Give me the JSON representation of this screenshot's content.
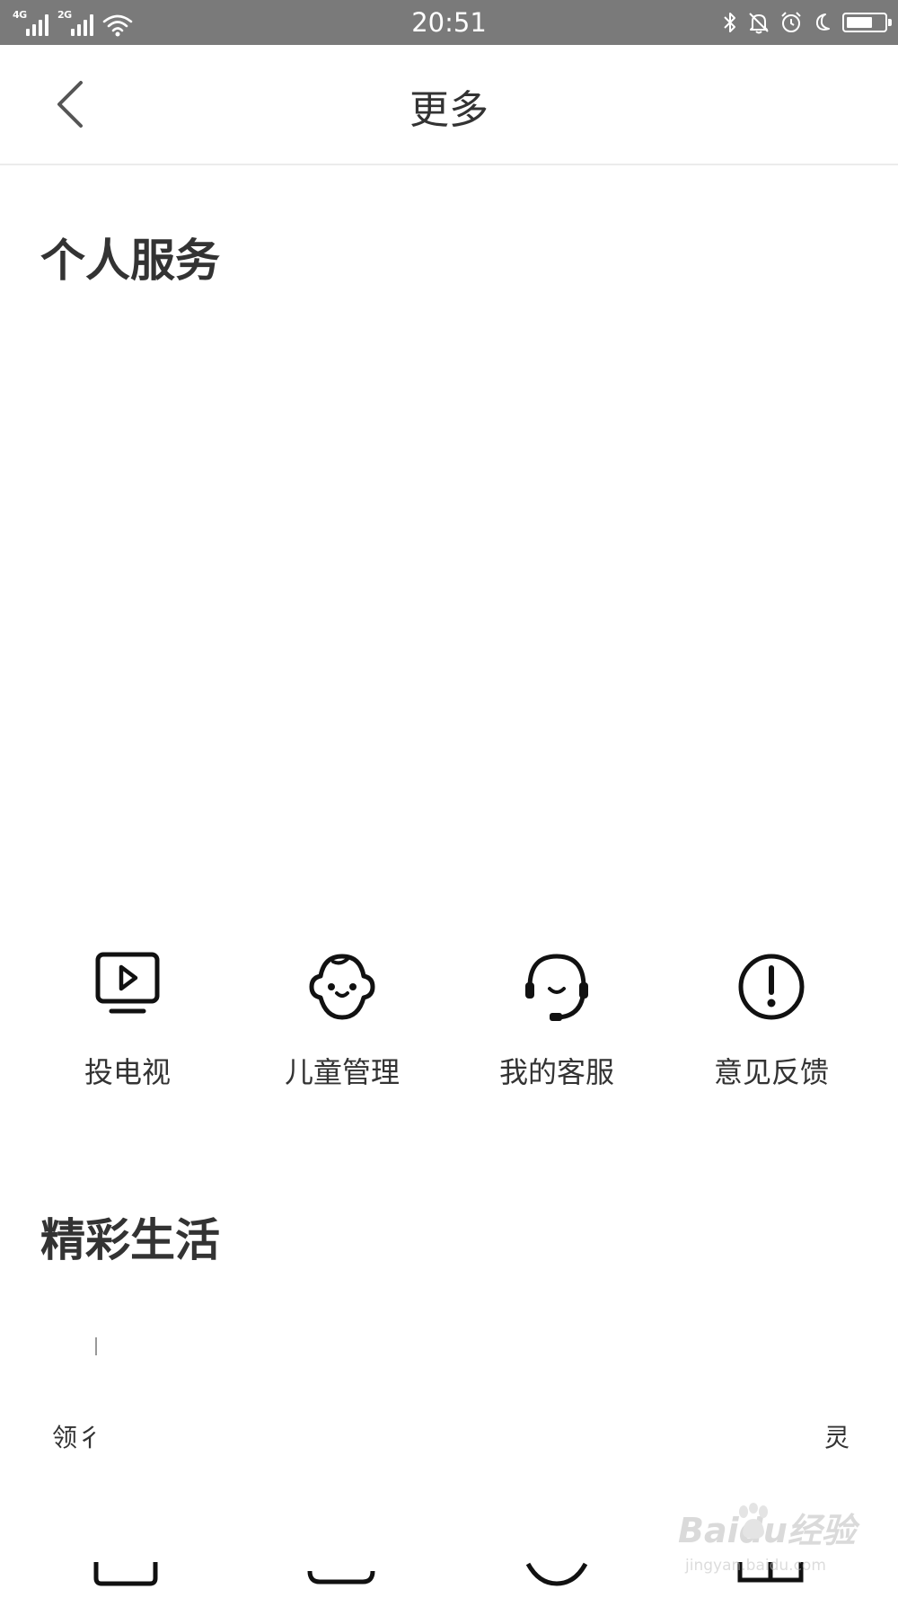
{
  "status_bar": {
    "time": "20:51",
    "networks": [
      "4G",
      "2G"
    ],
    "icons": [
      "signal-icon",
      "wifi-icon",
      "bluetooth-icon",
      "bell-off-icon",
      "alarm-icon",
      "moon-icon",
      "battery-icon"
    ]
  },
  "nav": {
    "title": "更多",
    "back_icon": "chevron-left-icon"
  },
  "personal_services": {
    "title": "个人服务",
    "items": [
      {
        "label": "投电视",
        "icon": "tv-play-icon"
      },
      {
        "label": "儿童管理",
        "icon": "child-face-icon"
      },
      {
        "label": "我的客服",
        "icon": "customer-service-icon"
      },
      {
        "label": "意见反馈",
        "icon": "feedback-exclamation-icon"
      }
    ]
  },
  "wonderful_life": {
    "title": "精彩生活",
    "partial_left_label": "领彳",
    "partial_right_label": "灵"
  },
  "watermark": {
    "brand": "Baidu经验",
    "url": "jingyan.baidu.com"
  },
  "colors": {
    "status_bar_bg": "#7a7a7a",
    "text": "#333333",
    "divider": "#ececec",
    "background": "#ffffff"
  }
}
